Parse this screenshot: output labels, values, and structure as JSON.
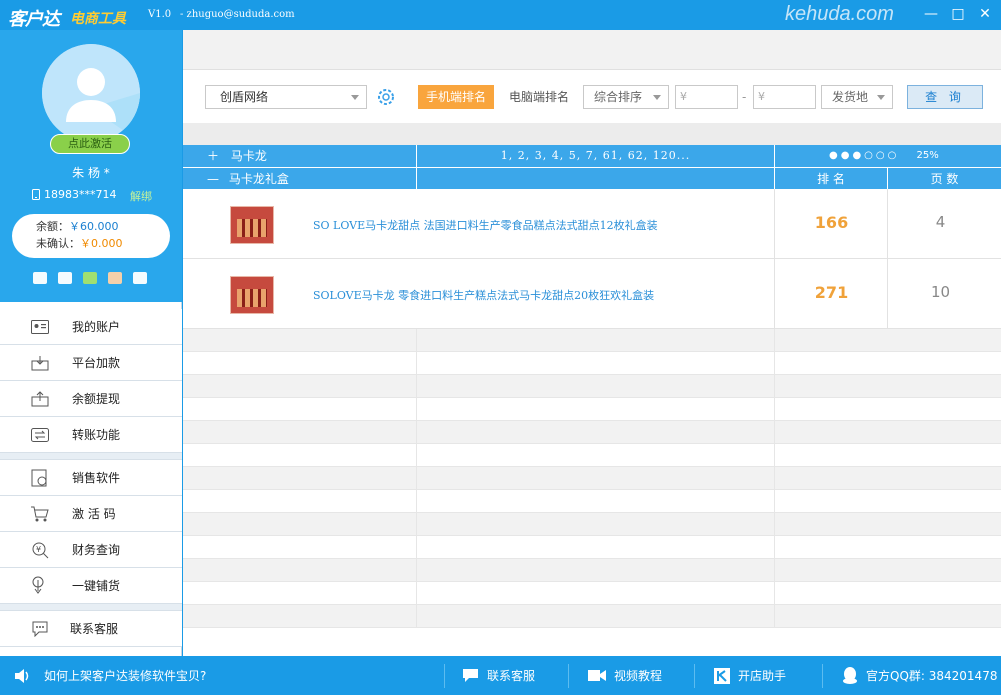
{
  "titlebar": {
    "logo": "客户达",
    "logo_sub": "电商工具",
    "version": "V1.0",
    "email": "- zhuguo@sududa.com",
    "watermark": "kehuda.com",
    "minimize": "—",
    "maximize": "□",
    "close": "✕"
  },
  "profile": {
    "activate_label": "点此激活",
    "username": "朱 杨 *",
    "phone": "18983***714",
    "unbind_label": "解绑",
    "balance_label": "余额：",
    "balance_value": "￥60.000",
    "pending_label": "未确认：",
    "pending_value": "￥0.000"
  },
  "menu_group1": [
    {
      "label": "我的账户",
      "icon": "account-card-icon"
    },
    {
      "label": "平台加款",
      "icon": "deposit-icon"
    },
    {
      "label": "余额提现",
      "icon": "withdraw-icon"
    },
    {
      "label": "转账功能",
      "icon": "transfer-icon"
    }
  ],
  "menu_group2": [
    {
      "label": "销售软件",
      "icon": "software-icon"
    },
    {
      "label": "激 活 码",
      "icon": "cart-icon"
    },
    {
      "label": "财务查询",
      "icon": "finance-search-icon"
    },
    {
      "label": "一键铺货",
      "icon": "one-click-icon"
    }
  ],
  "menu_group3": [
    {
      "label": "联系客服",
      "icon": "chat-icon"
    }
  ],
  "toolbar": {
    "shop_select": "创盾网络",
    "mobile_tab": "手机端排名",
    "pc_tab": "电脑端排名",
    "sort_select": "综合排序",
    "price_min_placeholder": "¥",
    "price_max_placeholder": "¥",
    "price_dash": "-",
    "ship_select": "发货地",
    "query_label": "查 询"
  },
  "table": {
    "keyword1_toggle": "＋",
    "keyword1": "马卡龙",
    "keyword1_pages": "1, 2, 3, 4, 5, 7, 61, 62, 120...",
    "keyword1_progress_dots": "●●●○○○",
    "keyword1_progress": "25%",
    "keyword2_toggle": "—",
    "keyword2": "马卡龙礼盒",
    "col_rank": "排 名",
    "col_page": "页 数",
    "products": [
      {
        "title": "SO LOVE马卡龙甜点 法国进口料生产零食品糕点法式甜点12枚礼盒装",
        "rank": "166",
        "page": "4"
      },
      {
        "title": "SOLOVE马卡龙 零食进口料生产糕点法式马卡龙甜点20枚狂欢礼盒装",
        "rank": "271",
        "page": "10"
      }
    ]
  },
  "bottom": {
    "tip": "如何上架客户达装修软件宝贝?",
    "service": "联系客服",
    "video": "视频教程",
    "assistant": "开店助手",
    "qq_group": "官方QQ群: 384201478"
  }
}
